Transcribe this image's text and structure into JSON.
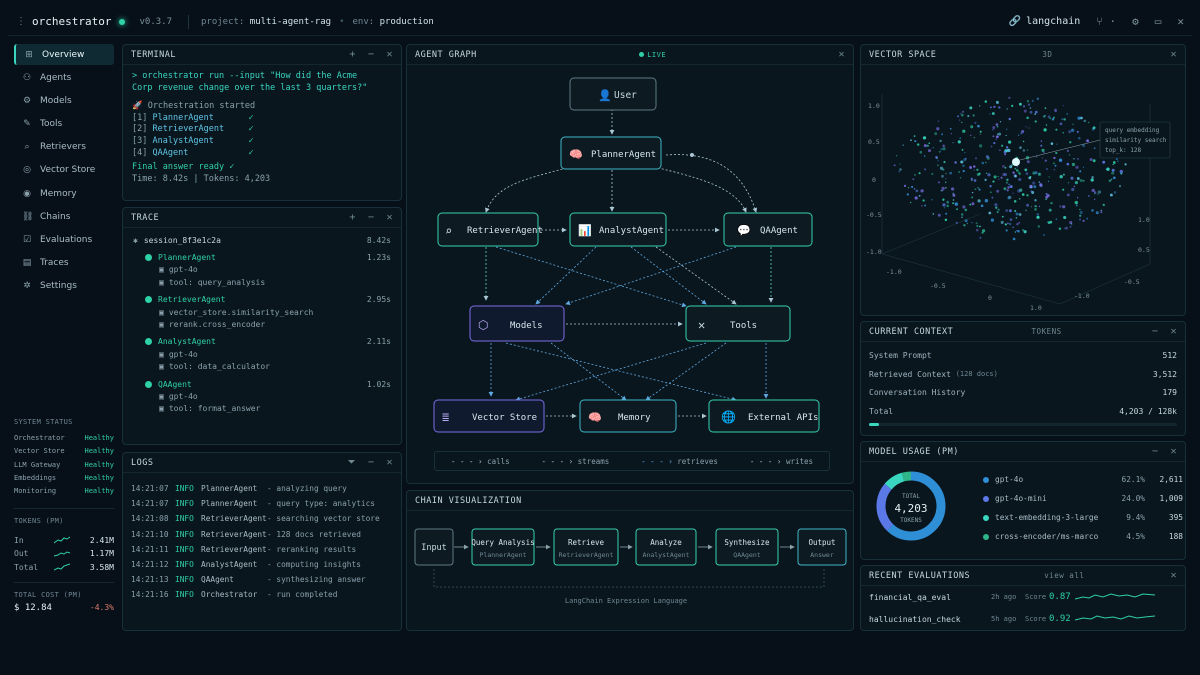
{
  "topbar": {
    "menu_glyph": "⋮",
    "app": "orchestrator",
    "version": "v0.3.7",
    "project_label": "project:",
    "project": "multi-agent-rag",
    "env_label": "env:",
    "env": "production",
    "langchain": "langchain"
  },
  "sidebar": {
    "items": [
      {
        "label": "Overview",
        "icon": "grid-icon"
      },
      {
        "label": "Agents",
        "icon": "agents-icon"
      },
      {
        "label": "Models",
        "icon": "models-icon"
      },
      {
        "label": "Tools",
        "icon": "tools-icon"
      },
      {
        "label": "Retrievers",
        "icon": "retrievers-icon"
      },
      {
        "label": "Vector Store",
        "icon": "vector-store-icon"
      },
      {
        "label": "Memory",
        "icon": "memory-icon"
      },
      {
        "label": "Chains",
        "icon": "chains-icon"
      },
      {
        "label": "Evaluations",
        "icon": "evaluations-icon"
      },
      {
        "label": "Traces",
        "icon": "traces-icon"
      },
      {
        "label": "Settings",
        "icon": "settings-icon"
      }
    ]
  },
  "system_status": {
    "title": "SYSTEM STATUS",
    "rows": [
      {
        "name": "Orchestrator",
        "status": "Healthy"
      },
      {
        "name": "Vector Store",
        "status": "Healthy"
      },
      {
        "name": "LLM Gateway",
        "status": "Healthy"
      },
      {
        "name": "Embeddings",
        "status": "Healthy"
      },
      {
        "name": "Monitoring",
        "status": "Healthy"
      }
    ],
    "tokens_title": "TOKENS (PM)",
    "tokens": [
      {
        "label": "In",
        "value": "2.41M"
      },
      {
        "label": "Out",
        "value": "1.17M"
      },
      {
        "label": "Total",
        "value": "3.58M"
      }
    ],
    "cost_title": "TOTAL COST (PM)",
    "cost": "$ 12.84",
    "cost_delta": "-4.3%"
  },
  "terminal": {
    "title": "TERMINAL",
    "prompt": "> orchestrator run --input \"How did the Acme Corp revenue change over the last 3 quarters?\"",
    "started": "🚀 Orchestration started",
    "steps": [
      {
        "idx": "[1]",
        "agent": "PlannerAgent",
        "check": "✓"
      },
      {
        "idx": "[2]",
        "agent": "RetrieverAgent",
        "check": "✓"
      },
      {
        "idx": "[3]",
        "agent": "AnalystAgent",
        "check": "✓"
      },
      {
        "idx": "[4]",
        "agent": "QAAgent",
        "check": "✓"
      }
    ],
    "final": "Final answer ready ✓",
    "stats": "Time: 8.42s  |  Tokens: 4,203"
  },
  "trace": {
    "title": "TRACE",
    "session": "session_8f3e1c2a",
    "session_time": "8.42s",
    "agents": [
      {
        "name": "PlannerAgent",
        "time": "1.23s",
        "subs": [
          "gpt-4o",
          "tool: query_analysis"
        ]
      },
      {
        "name": "RetrieverAgent",
        "time": "2.95s",
        "subs": [
          "vector_store.similarity_search",
          "rerank.cross_encoder"
        ]
      },
      {
        "name": "AnalystAgent",
        "time": "2.11s",
        "subs": [
          "gpt-4o",
          "tool: data_calculator"
        ]
      },
      {
        "name": "QAAgent",
        "time": "1.02s",
        "subs": [
          "gpt-4o",
          "tool: format_answer"
        ]
      }
    ]
  },
  "logs": {
    "title": "LOGS",
    "rows": [
      {
        "ts": "14:21:07",
        "lv": "INFO",
        "src": "PlannerAgent",
        "msg": "- analyzing query"
      },
      {
        "ts": "14:21:07",
        "lv": "INFO",
        "src": "PlannerAgent",
        "msg": "- query type: analytics"
      },
      {
        "ts": "14:21:08",
        "lv": "INFO",
        "src": "RetrieverAgent",
        "msg": "- searching vector store"
      },
      {
        "ts": "14:21:10",
        "lv": "INFO",
        "src": "RetrieverAgent",
        "msg": "- 128 docs retrieved"
      },
      {
        "ts": "14:21:11",
        "lv": "INFO",
        "src": "RetrieverAgent",
        "msg": "- reranking results"
      },
      {
        "ts": "14:21:12",
        "lv": "INFO",
        "src": "AnalystAgent",
        "msg": "- computing insights"
      },
      {
        "ts": "14:21:13",
        "lv": "INFO",
        "src": "QAAgent",
        "msg": "- synthesizing answer"
      },
      {
        "ts": "14:21:16",
        "lv": "INFO",
        "src": "Orchestrator",
        "msg": "- run completed"
      }
    ]
  },
  "graph": {
    "title": "AGENT GRAPH",
    "live": "LIVE",
    "nodes": {
      "user": "User",
      "planner": "PlannerAgent",
      "retriever": "RetrieverAgent",
      "analyst": "AnalystAgent",
      "qa": "QAAgent",
      "models": "Models",
      "tools": "Tools",
      "vector": "Vector Store",
      "memory": "Memory",
      "apis": "External APIs"
    },
    "legend": [
      "calls",
      "streams",
      "retrieves",
      "writes"
    ]
  },
  "chain": {
    "title": "CHAIN VISUALIZATION",
    "steps": [
      {
        "name": "Input",
        "sub": ""
      },
      {
        "name": "Query Analysis",
        "sub": "PlannerAgent"
      },
      {
        "name": "Retrieve",
        "sub": "RetrieverAgent"
      },
      {
        "name": "Analyze",
        "sub": "AnalystAgent"
      },
      {
        "name": "Synthesize",
        "sub": "QAAgent"
      },
      {
        "name": "Output",
        "sub": "Answer"
      }
    ],
    "caption": "LangChain Expression Language"
  },
  "vector_space": {
    "title": "VECTOR SPACE",
    "mode": "3D",
    "annotation": [
      "query embedding",
      "similarity search",
      "top_k: 128"
    ],
    "ticks_y": [
      "1.0",
      "0.5",
      "0",
      "-0.5",
      "-1.0"
    ],
    "ticks_x": [
      "-1.0",
      "-0.5",
      "0",
      "0.5",
      "1.0"
    ],
    "ticks_z": [
      "1.0",
      "0.5",
      "-0.5",
      "-1.0"
    ]
  },
  "context": {
    "title": "CURRENT CONTEXT",
    "tag": "TOKENS",
    "rows": [
      {
        "name": "System Prompt",
        "note": "",
        "value": "512"
      },
      {
        "name": "Retrieved Context",
        "note": "(128 docs)",
        "value": "3,512"
      },
      {
        "name": "Conversation History",
        "note": "",
        "value": "179"
      },
      {
        "name": "Total",
        "note": "",
        "value": "4,203 / 128k"
      }
    ],
    "fill_fraction": 0.033
  },
  "model_usage": {
    "title": "MODEL USAGE (PM)",
    "donut_label": "TOTAL",
    "donut_value": "4,203",
    "donut_unit": "TOKENS",
    "models": [
      {
        "name": "gpt-4o",
        "pct": "62.1%",
        "count": "2,611",
        "color": "#2f8fd6",
        "share": 62.1
      },
      {
        "name": "gpt-4o-mini",
        "pct": "24.0%",
        "count": "1,009",
        "color": "#5b79e6",
        "share": 24.0
      },
      {
        "name": "text-embedding-3-large",
        "pct": "9.4%",
        "count": "395",
        "color": "#39d6c0",
        "share": 9.4
      },
      {
        "name": "cross-encoder/ms-marco",
        "pct": "4.5%",
        "count": "188",
        "color": "#2fb58a",
        "share": 4.5
      }
    ]
  },
  "evaluations": {
    "title": "RECENT EVALUATIONS",
    "view_all": "view all",
    "score_label": "Score",
    "rows": [
      {
        "name": "financial_qa_eval",
        "age": "2h ago",
        "score": "0.87"
      },
      {
        "name": "hallucination_check",
        "age": "5h ago",
        "score": "0.92"
      }
    ]
  },
  "colors": {
    "accent": "#39d6c0",
    "ok": "#2fd1a6",
    "blue": "#2f8fd6",
    "purple": "#7a6ce6"
  }
}
